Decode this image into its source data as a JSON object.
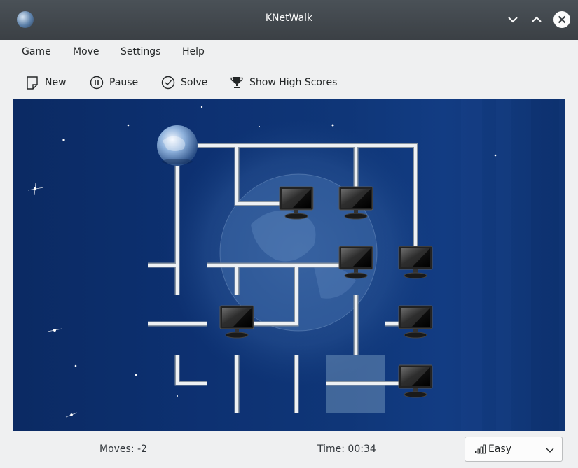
{
  "window": {
    "title": "KNetWalk"
  },
  "menu": {
    "items": [
      "Game",
      "Move",
      "Settings",
      "Help"
    ]
  },
  "toolbar": {
    "new_label": "New",
    "pause_label": "Pause",
    "solve_label": "Solve",
    "highscores_label": "Show High Scores"
  },
  "status": {
    "moves": "Moves: -2",
    "time": "Time: 00:34",
    "difficulty": "Easy"
  },
  "colors": {
    "titlebar": "#3b4045",
    "board_bg": "#0d3172",
    "pipe": "#e4e8ec",
    "selection": "#6c8fb8"
  },
  "board": {
    "columns": 5,
    "rows": 5,
    "server": {
      "col": 0,
      "row": 0
    },
    "terminals": [
      {
        "col": 2,
        "row": 1
      },
      {
        "col": 3,
        "row": 1
      },
      {
        "col": 3,
        "row": 2
      },
      {
        "col": 4,
        "row": 2
      },
      {
        "col": 1,
        "row": 3
      },
      {
        "col": 4,
        "row": 3
      },
      {
        "col": 4,
        "row": 4
      }
    ],
    "selected_cell": {
      "col": 3,
      "row": 4
    }
  }
}
